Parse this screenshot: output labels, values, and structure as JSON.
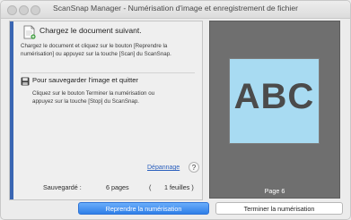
{
  "window": {
    "title": "ScanSnap Manager - Numérisation d'image et enregistrement de fichier"
  },
  "left_panel": {
    "section1": {
      "heading": "Chargez le document suivant.",
      "body_line1": "Chargez le document et cliquez sur le bouton [Reprendre la",
      "body_line2": "numérisation] ou appuyez sur la touche [Scan] du ScanSnap."
    },
    "section2": {
      "heading": "Pour sauvegarder l'image et quitter",
      "body_line1": "Cliquez sur le bouton Terminer la numérisation ou",
      "body_line2": "appuyez sur la touche [Stop] du ScanSnap."
    },
    "troubleshooting_link": "Dépannage",
    "help_label": "?",
    "saved": {
      "label": "Sauvegardé :",
      "pages": "6 pages",
      "open_paren": "(",
      "sheets": "1 feuilles )"
    }
  },
  "preview": {
    "thumbnail_text": "ABC",
    "page_label": "Page 6"
  },
  "buttons": {
    "resume": "Reprendre la numérisation",
    "finish": "Terminer la numérisation"
  },
  "colors": {
    "accent": "#3a66b3",
    "link": "#2a5fbd",
    "primary_button": "#2f7fe8",
    "thumbnail_bg": "#a8dbf2",
    "preview_bg": "#6f6f6f"
  }
}
